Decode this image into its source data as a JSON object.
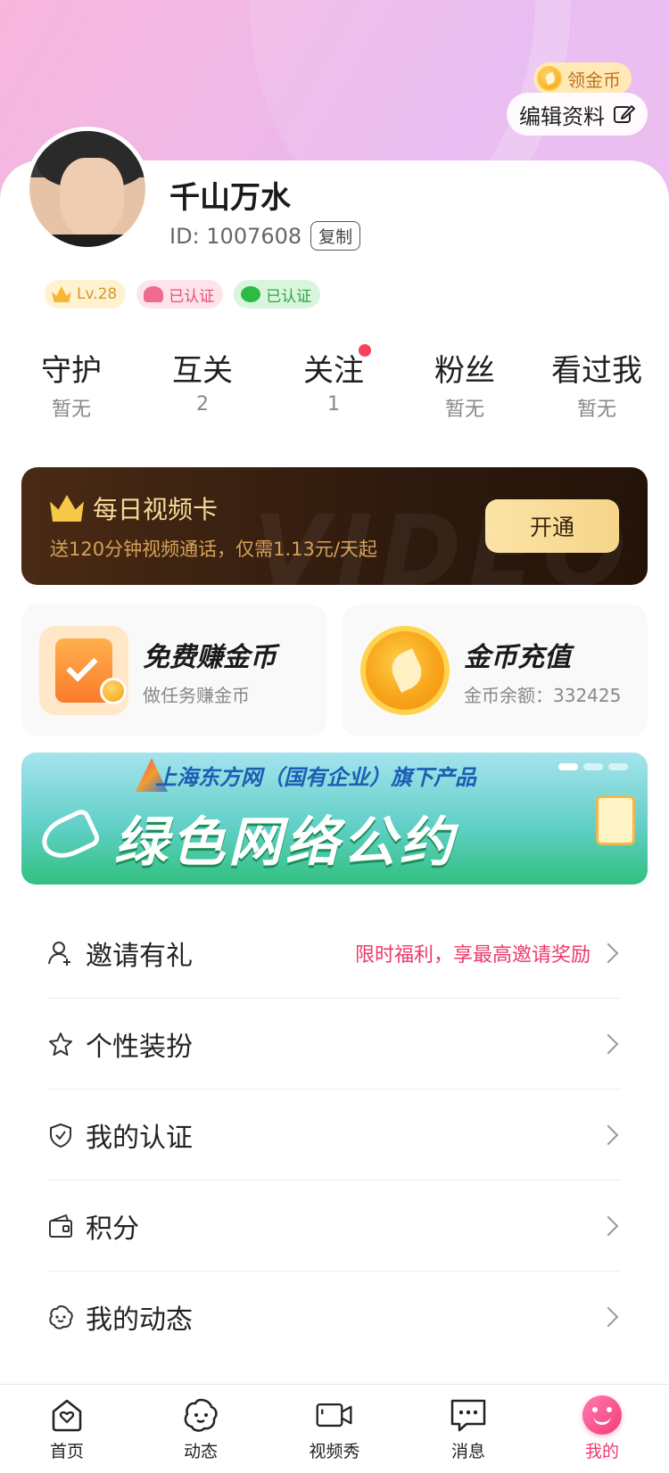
{
  "header": {
    "coin_badge_label": "领金币",
    "edit_profile_label": "编辑资料"
  },
  "profile": {
    "name": "千山万水",
    "id_text": "ID: 1007608",
    "copy_label": "复制",
    "badges": [
      {
        "icon": "gold-ingot-icon",
        "label": "Lv.28"
      },
      {
        "icon": "real-person-verified-icon",
        "label": "已认证"
      },
      {
        "icon": "wechat-icon",
        "label": "已认证"
      }
    ]
  },
  "stats": [
    {
      "label": "守护",
      "value": "暂无"
    },
    {
      "label": "互关",
      "value": "2"
    },
    {
      "label": "关注",
      "value": "1",
      "has_dot": true
    },
    {
      "label": "粉丝",
      "value": "暂无"
    },
    {
      "label": "看过我",
      "value": "暂无"
    }
  ],
  "video_card": {
    "title": "每日视频卡",
    "description": "送120分钟视频通话，仅需1.13元/天起",
    "button_label": "开通",
    "watermark": "VIDEO"
  },
  "tiles": [
    {
      "icon": "task-board-icon",
      "title": "免费赚金币",
      "subtitle": "做任务赚金币"
    },
    {
      "icon": "gold-coin-icon",
      "title": "金币充值",
      "subtitle": "金币余额：332425"
    }
  ],
  "banner": {
    "top_text": "上海东方网（国有企业）旗下产品",
    "main_text": "绿色网络公约",
    "page_indicator": {
      "current": 1,
      "total": 3
    }
  },
  "menu": [
    {
      "icon": "person-add-icon",
      "label": "邀请有礼",
      "hint": "限时福利，享最高邀请奖励"
    },
    {
      "icon": "star-icon",
      "label": "个性装扮",
      "hint": ""
    },
    {
      "icon": "shield-check-icon",
      "label": "我的认证",
      "hint": ""
    },
    {
      "icon": "wallet-icon",
      "label": "积分",
      "hint": ""
    },
    {
      "icon": "moments-face-icon",
      "label": "我的动态",
      "hint": ""
    }
  ],
  "tabbar": [
    {
      "icon": "home-heart-icon",
      "label": "首页"
    },
    {
      "icon": "moments-face-icon",
      "label": "动态"
    },
    {
      "icon": "video-camera-icon",
      "label": "视频秀"
    },
    {
      "icon": "chat-bubble-icon",
      "label": "消息"
    },
    {
      "icon": "smile-icon",
      "label": "我的",
      "active": true
    }
  ],
  "colors": {
    "accent_pink": "#ee3a6d",
    "gold": "#f6a10c",
    "vip_dark": "#2e1a0e"
  }
}
